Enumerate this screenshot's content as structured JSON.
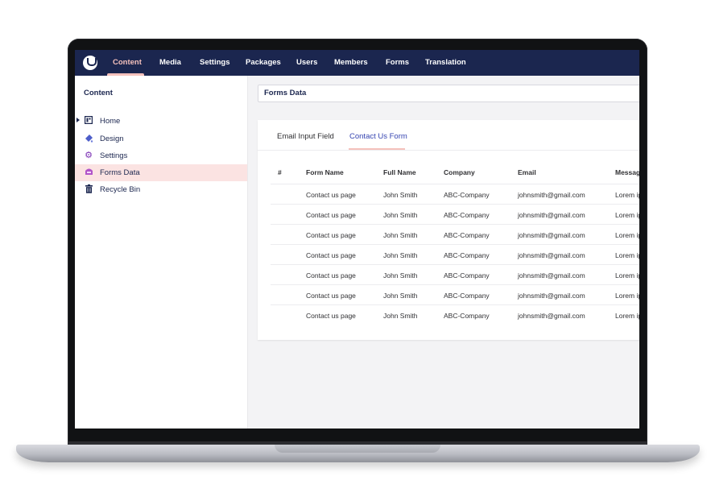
{
  "nav": {
    "items": [
      {
        "label": "Content",
        "active": true
      },
      {
        "label": "Media",
        "active": false
      },
      {
        "label": "Settings",
        "active": false
      },
      {
        "label": "Packages",
        "active": false
      },
      {
        "label": "Users",
        "active": false
      },
      {
        "label": "Members",
        "active": false
      },
      {
        "label": "Forms",
        "active": false
      },
      {
        "label": "Translation",
        "active": false
      }
    ]
  },
  "sidebar": {
    "title": "Content",
    "items": [
      {
        "label": "Home",
        "icon": "home-icon"
      },
      {
        "label": "Design",
        "icon": "design-icon"
      },
      {
        "label": "Settings",
        "icon": "gear-icon"
      },
      {
        "label": "Forms Data",
        "icon": "forms-icon",
        "selected": true
      },
      {
        "label": "Recycle Bin",
        "icon": "trash-icon"
      }
    ]
  },
  "main": {
    "header_title": "Forms Data",
    "tabs": [
      {
        "label": "Email Input Field",
        "active": false
      },
      {
        "label": "Contact Us Form",
        "active": true
      }
    ],
    "table": {
      "columns": [
        "#",
        "Form Name",
        "Full Name",
        "Company",
        "Email",
        "Message"
      ],
      "rows": [
        [
          "",
          "Contact us page",
          "John Smith",
          "ABC-Company",
          "johnsmith@gmail.com",
          "Lorem ip"
        ],
        [
          "",
          "Contact us page",
          "John Smith",
          "ABC-Company",
          "johnsmith@gmail.com",
          "Lorem ip"
        ],
        [
          "",
          "Contact us page",
          "John Smith",
          "ABC-Company",
          "johnsmith@gmail.com",
          "Lorem ip"
        ],
        [
          "",
          "Contact us page",
          "John Smith",
          "ABC-Company",
          "johnsmith@gmail.com",
          "Lorem ip"
        ],
        [
          "",
          "Contact us page",
          "John Smith",
          "ABC-Company",
          "johnsmith@gmail.com",
          "Lorem ip"
        ],
        [
          "",
          "Contact us page",
          "John Smith",
          "ABC-Company",
          "johnsmith@gmail.com",
          "Lorem ip"
        ],
        [
          "",
          "Contact us page",
          "John Smith",
          "ABC-Company",
          "johnsmith@gmail.com",
          "Lorem ip"
        ]
      ]
    }
  },
  "colors": {
    "nav_bg": "#1b264f",
    "accent": "#f5c1bc",
    "selected_bg": "#fbe3e2",
    "active_tab": "#3544b1"
  }
}
